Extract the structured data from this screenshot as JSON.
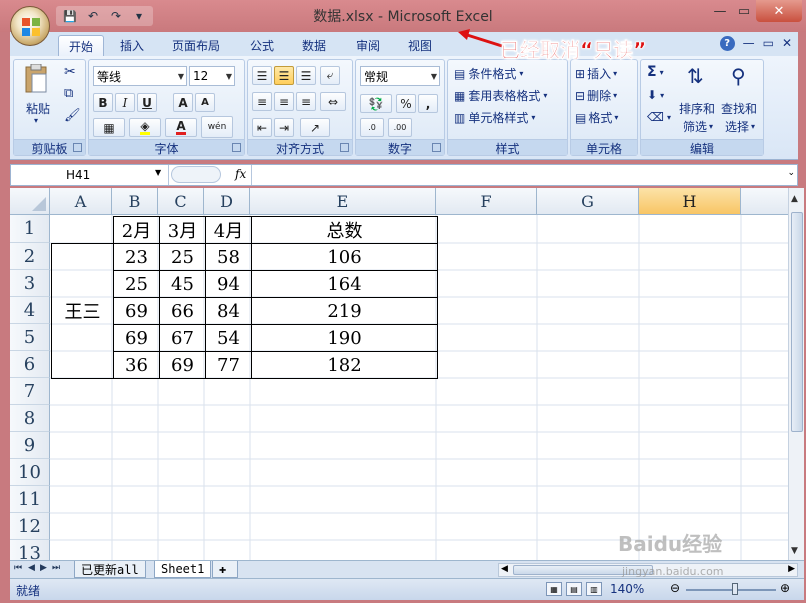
{
  "window": {
    "title": "数据.xlsx - Microsoft Excel",
    "controls": {
      "minimize": "—",
      "restore": "▭",
      "close": "✕"
    }
  },
  "qat": {
    "save": "💾",
    "undo": "↶",
    "redo": "↷",
    "customize": "▾"
  },
  "ribbon": {
    "tabs": [
      "开始",
      "插入",
      "页面布局",
      "公式",
      "数据",
      "审阅",
      "视图"
    ],
    "active_tab": "开始",
    "right": {
      "help": "?",
      "min": "—",
      "restore": "▭",
      "close": "✕"
    },
    "clipboard": {
      "paste": "粘贴",
      "label": "剪贴板"
    },
    "font": {
      "name": "等线",
      "size": "12",
      "bold": "B",
      "italic": "I",
      "underline": "U",
      "grow": "A",
      "shrink": "A",
      "fill": "A",
      "wen": "wén",
      "label": "字体",
      "color_accent": "#e02020",
      "fill_accent": "#ffff00"
    },
    "alignment": {
      "label": "对齐方式"
    },
    "number": {
      "format": "常规",
      "percent": "%",
      "comma": ",",
      "inc": ".0",
      "dec": ".00",
      "label": "数字"
    },
    "styles": {
      "cond": "条件格式",
      "table": "套用表格格式",
      "cell": "单元格样式",
      "label": "样式"
    },
    "cells": {
      "insert": "插入",
      "delete": "删除",
      "format": "格式",
      "label": "单元格"
    },
    "editing": {
      "sum": "Σ",
      "sort_l1": "排序和",
      "sort_l2": "筛选",
      "find_l1": "查找和",
      "find_l2": "选择",
      "label": "编辑"
    }
  },
  "formula_bar": {
    "name_box": "H41",
    "fx": "fx",
    "formula": ""
  },
  "grid": {
    "columns": [
      "A",
      "B",
      "C",
      "D",
      "E",
      "F",
      "G",
      "H"
    ],
    "selected_column": "H",
    "rows": [
      "1",
      "2",
      "3",
      "4",
      "5",
      "6",
      "7",
      "8",
      "9",
      "10",
      "11",
      "12",
      "13"
    ],
    "header_row": [
      "",
      "2月",
      "3月",
      "4月",
      "总数"
    ],
    "merged_name": "王三",
    "data": [
      [
        "23",
        "25",
        "58",
        "106"
      ],
      [
        "25",
        "45",
        "94",
        "164"
      ],
      [
        "69",
        "66",
        "84",
        "219"
      ],
      [
        "69",
        "67",
        "54",
        "190"
      ],
      [
        "36",
        "69",
        "77",
        "182"
      ]
    ]
  },
  "sheets": {
    "tabs": [
      "已更新all",
      "Sheet1"
    ],
    "active": "Sheet1"
  },
  "status": {
    "text": "就绪",
    "zoom": "140%"
  },
  "annotation": "已经取消“只读”",
  "watermark": {
    "brand": "Baidu经验",
    "url": "jingyan.baidu.com"
  }
}
